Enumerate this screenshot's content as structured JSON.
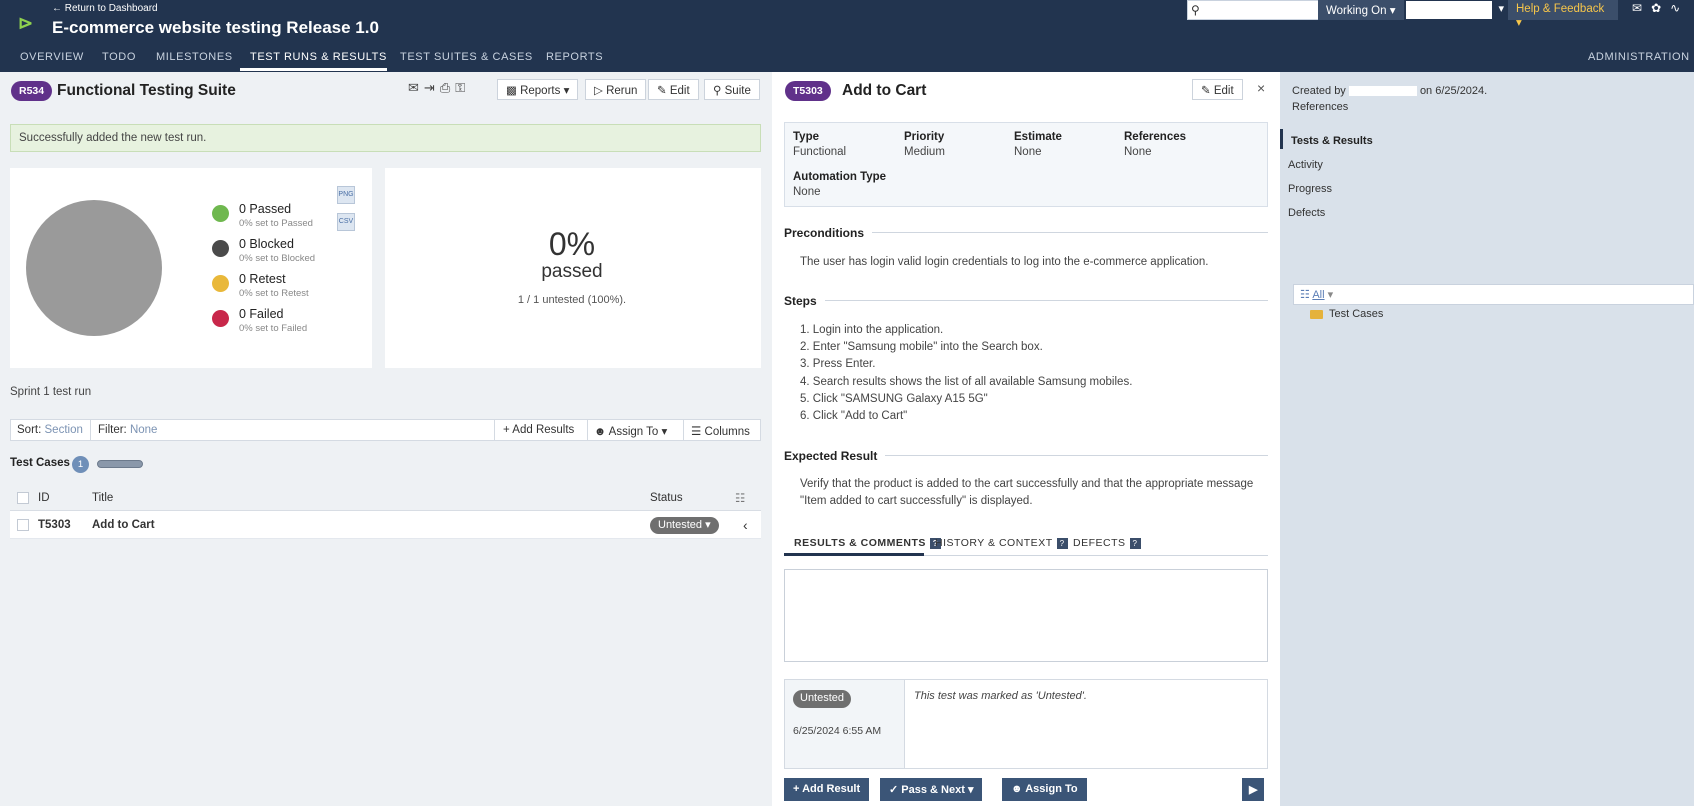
{
  "header": {
    "back_link": "← Return to Dashboard",
    "project_title": "E-commerce website testing Release 1.0",
    "working_on": "Working On",
    "help": "Help & Feedback",
    "nav": [
      "OVERVIEW",
      "TODO",
      "MILESTONES",
      "TEST RUNS & RESULTS",
      "TEST SUITES & CASES",
      "REPORTS"
    ],
    "admin": "ADMINISTRATION",
    "accent": "#22344f"
  },
  "run": {
    "id": "R534",
    "title": "Functional Testing Suite",
    "toolbar": {
      "reports": "Reports",
      "rerun": "Rerun",
      "edit": "Edit",
      "suite": "Suite"
    },
    "success_message": "Successfully added the new test run.",
    "legend": [
      {
        "label": "0 Passed",
        "sub": "0% set to Passed",
        "color": "#6fb84f"
      },
      {
        "label": "0 Blocked",
        "sub": "0% set to Blocked",
        "color": "#4a4a4a"
      },
      {
        "label": "0 Retest",
        "sub": "0% set to Retest",
        "color": "#e9b83a"
      },
      {
        "label": "0 Failed",
        "sub": "0% set to Failed",
        "color": "#c8274a"
      }
    ],
    "export": {
      "chart": "PNG",
      "csv": "CSV"
    },
    "percent": "0%",
    "percent_label": "passed",
    "untested_summary": "1 / 1 untested (100%).",
    "description": "Sprint 1 test run",
    "filterbar": {
      "sort_label": "Sort:",
      "sort_value": "Section",
      "filter_label": "Filter:",
      "filter_value": "None",
      "add_results": "Add Results",
      "assign_to": "Assign To",
      "columns": "Columns"
    },
    "test_cases_label": "Test Cases",
    "test_cases_count": "1",
    "columns": {
      "id": "ID",
      "title": "Title",
      "status": "Status"
    },
    "rows": [
      {
        "id": "T5303",
        "title": "Add to Cart",
        "status": "Untested"
      }
    ]
  },
  "case": {
    "id": "T5303",
    "title": "Add to Cart",
    "edit": "Edit",
    "props": {
      "type_label": "Type",
      "type": "Functional",
      "priority_label": "Priority",
      "priority": "Medium",
      "estimate_label": "Estimate",
      "estimate": "None",
      "references_label": "References",
      "references": "None",
      "automation_label": "Automation Type",
      "automation": "None"
    },
    "preconditions_title": "Preconditions",
    "preconditions": "The user has login valid login credentials to log into the e-commerce application.",
    "steps_title": "Steps",
    "steps": [
      "1. Login into the application.",
      "2. Enter \"Samsung mobile\" into the Search box.",
      "3. Press Enter.",
      "4. Search results shows the list of all available Samsung mobiles.",
      "5. Click \"SAMSUNG Galaxy A15 5G\"",
      "6. Click \"Add to Cart\""
    ],
    "expected_title": "Expected Result",
    "expected_line1": "Verify that the product is added to the cart successfully and that the appropriate message",
    "expected_line2": "\"Item added to cart successfully\" is displayed.",
    "tabs": [
      "RESULTS & COMMENTS",
      "HISTORY & CONTEXT",
      "DEFECTS"
    ],
    "history": {
      "status": "Untested",
      "date": "6/25/2024 6:55 AM",
      "message": "This test was marked as 'Untested'."
    },
    "actions": {
      "add_result": "Add Result",
      "pass_next": "Pass & Next",
      "assign_to": "Assign To"
    }
  },
  "sidebar": {
    "created_prefix": "Created by",
    "created_suffix": "on 6/25/2024.",
    "references": "References",
    "nav": [
      "Tests & Results",
      "Activity",
      "Progress",
      "Defects"
    ],
    "tree_all": "All",
    "tree_folder": "Test Cases"
  }
}
